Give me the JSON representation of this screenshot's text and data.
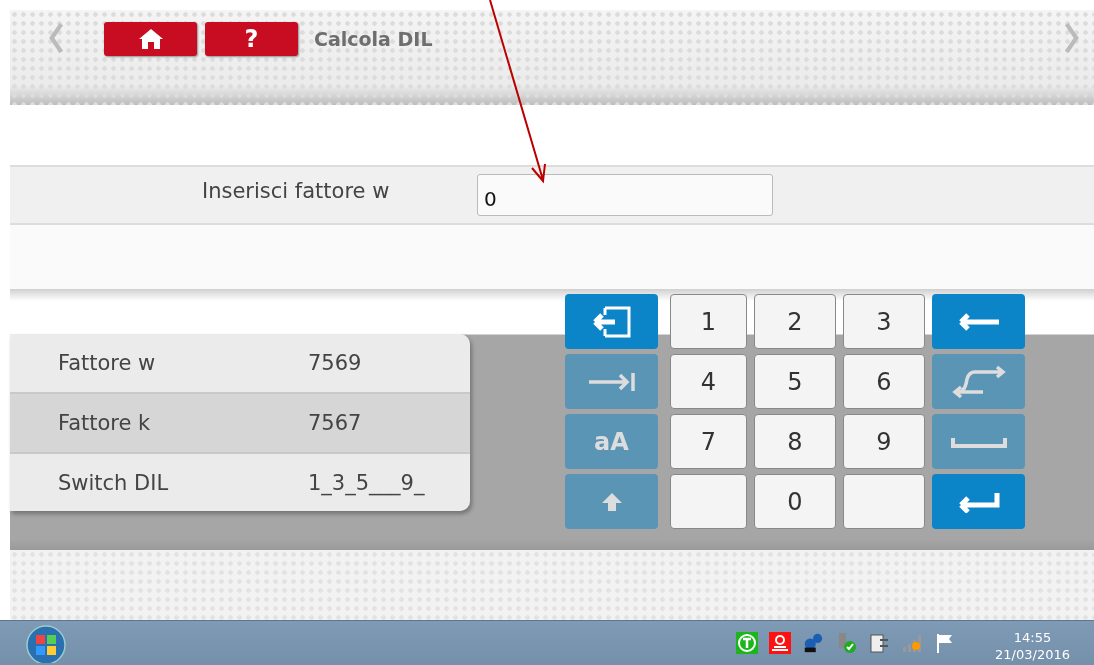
{
  "header": {
    "title": "Calcola DIL",
    "buttons": [
      {
        "kind": "home"
      },
      {
        "kind": "help",
        "label": "?"
      }
    ]
  },
  "input": {
    "label": "Inserisci fattore w",
    "value": "0"
  },
  "info_rows": [
    {
      "label": "Fattore w",
      "value": "7569"
    },
    {
      "label": "Fattore k",
      "value": "7567"
    },
    {
      "label": "Switch DIL",
      "value": "1_3_5___9_"
    }
  ],
  "keyboard": [
    {
      "kind": "exit",
      "disabled": false
    },
    {
      "kind": "digit",
      "label": "1"
    },
    {
      "kind": "digit",
      "label": "2"
    },
    {
      "kind": "digit",
      "label": "3"
    },
    {
      "kind": "backspace",
      "disabled": false
    },
    {
      "kind": "tab",
      "disabled": true
    },
    {
      "kind": "digit",
      "label": "4"
    },
    {
      "kind": "digit",
      "label": "5"
    },
    {
      "kind": "digit",
      "label": "6"
    },
    {
      "kind": "swap",
      "disabled": true
    },
    {
      "kind": "case",
      "label": "aA",
      "disabled": true
    },
    {
      "kind": "digit",
      "label": "7"
    },
    {
      "kind": "digit",
      "label": "8"
    },
    {
      "kind": "digit",
      "label": "9"
    },
    {
      "kind": "space",
      "disabled": true
    },
    {
      "kind": "shift",
      "disabled": true
    },
    {
      "kind": "blank"
    },
    {
      "kind": "digit",
      "label": "0"
    },
    {
      "kind": "blank"
    },
    {
      "kind": "enter",
      "disabled": false
    }
  ],
  "taskbar": {
    "time": "14:55",
    "date": "21/03/2016"
  }
}
